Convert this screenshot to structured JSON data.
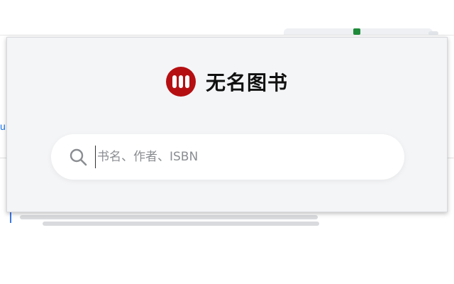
{
  "brand": {
    "name": "无名图书",
    "logo_color": "#b50f12"
  },
  "search": {
    "placeholder": "书名、作者、ISBN",
    "value": "",
    "icon": "search-icon"
  },
  "background_page": {
    "sidebar_letter": "u",
    "accent_color": "#1a73e8"
  }
}
